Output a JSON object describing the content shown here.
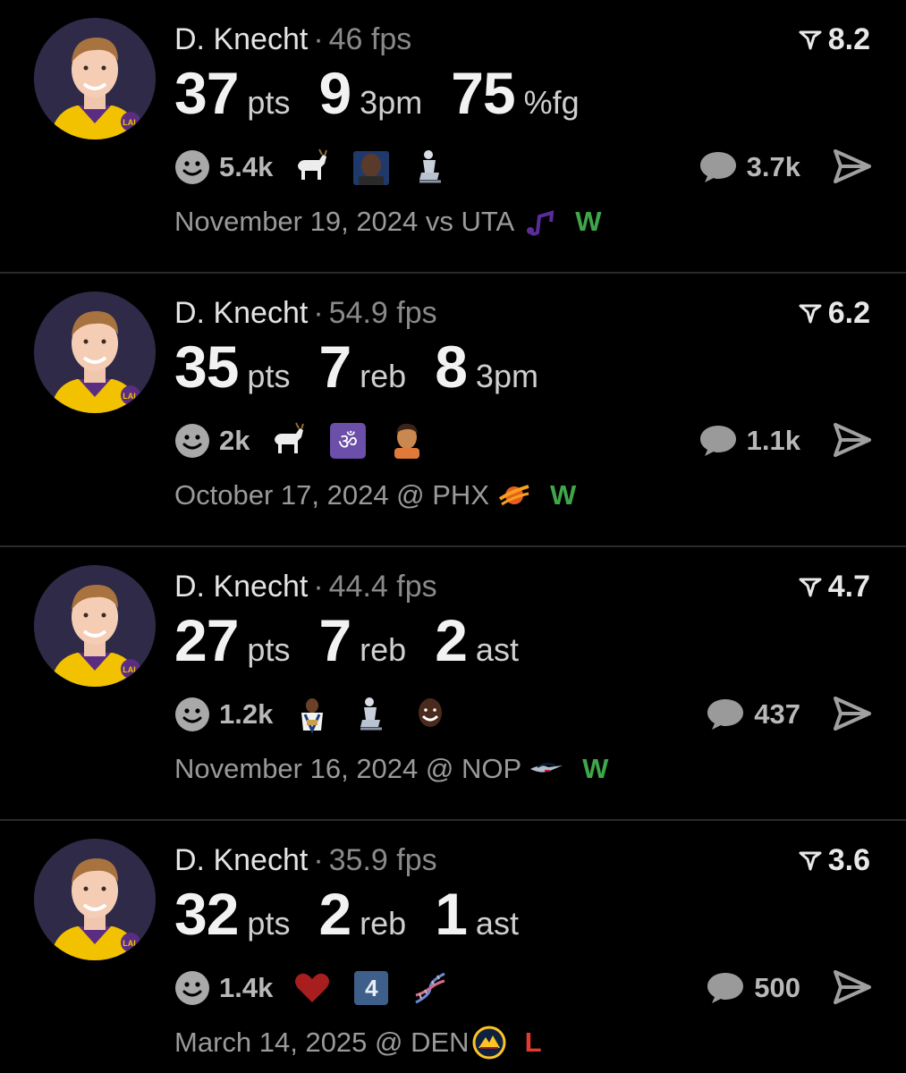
{
  "colors": {
    "background": "#000000",
    "win": "#3fa64a",
    "loss": "#e23a33",
    "muted": "#9a9a9a"
  },
  "posts": [
    {
      "player": "D. Knecht",
      "separator": "·",
      "fps": "46 fps",
      "rating": "8.2",
      "stats": [
        {
          "value": "37",
          "unit": "pts"
        },
        {
          "value": "9",
          "unit": "3pm"
        },
        {
          "value": "75",
          "unit": "%fg"
        }
      ],
      "reactions": {
        "count": "5.4k",
        "icons": [
          "goat-icon",
          "person-emoji-icon",
          "statue-icon"
        ]
      },
      "comments": "3.7k",
      "date_opponent": "November 19, 2024 vs UTA",
      "team_logo": "jazz-logo-icon",
      "result": "W"
    },
    {
      "player": "D. Knecht",
      "separator": "·",
      "fps": "54.9 fps",
      "rating": "6.2",
      "stats": [
        {
          "value": "35",
          "unit": "pts"
        },
        {
          "value": "7",
          "unit": "reb"
        },
        {
          "value": "8",
          "unit": "3pm"
        }
      ],
      "reactions": {
        "count": "2k",
        "icons": [
          "goat-icon",
          "om-icon",
          "person-emoji-icon"
        ]
      },
      "comments": "1.1k",
      "date_opponent": "October 17, 2024 @ PHX",
      "team_logo": "suns-logo-icon",
      "result": "W"
    },
    {
      "player": "D. Knecht",
      "separator": "·",
      "fps": "44.4 fps",
      "rating": "4.7",
      "stats": [
        {
          "value": "27",
          "unit": "pts"
        },
        {
          "value": "7",
          "unit": "reb"
        },
        {
          "value": "2",
          "unit": "ast"
        }
      ],
      "reactions": {
        "count": "1.2k",
        "icons": [
          "person-emoji-icon",
          "statue-icon",
          "person-emoji-icon"
        ]
      },
      "comments": "437",
      "date_opponent": "November 16, 2024 @ NOP",
      "team_logo": "pelicans-logo-icon",
      "result": "W"
    },
    {
      "player": "D. Knecht",
      "separator": "·",
      "fps": "35.9 fps",
      "rating": "3.6",
      "stats": [
        {
          "value": "32",
          "unit": "pts"
        },
        {
          "value": "2",
          "unit": "reb"
        },
        {
          "value": "1",
          "unit": "ast"
        }
      ],
      "reactions": {
        "count": "1.4k",
        "icons": [
          "heart-icon",
          "keycap-4-icon",
          "dna-icon"
        ],
        "keycap_label": "4"
      },
      "comments": "500",
      "date_opponent": "March 14, 2025 @ DEN",
      "team_logo": "nuggets-logo-icon",
      "result": "L"
    }
  ]
}
